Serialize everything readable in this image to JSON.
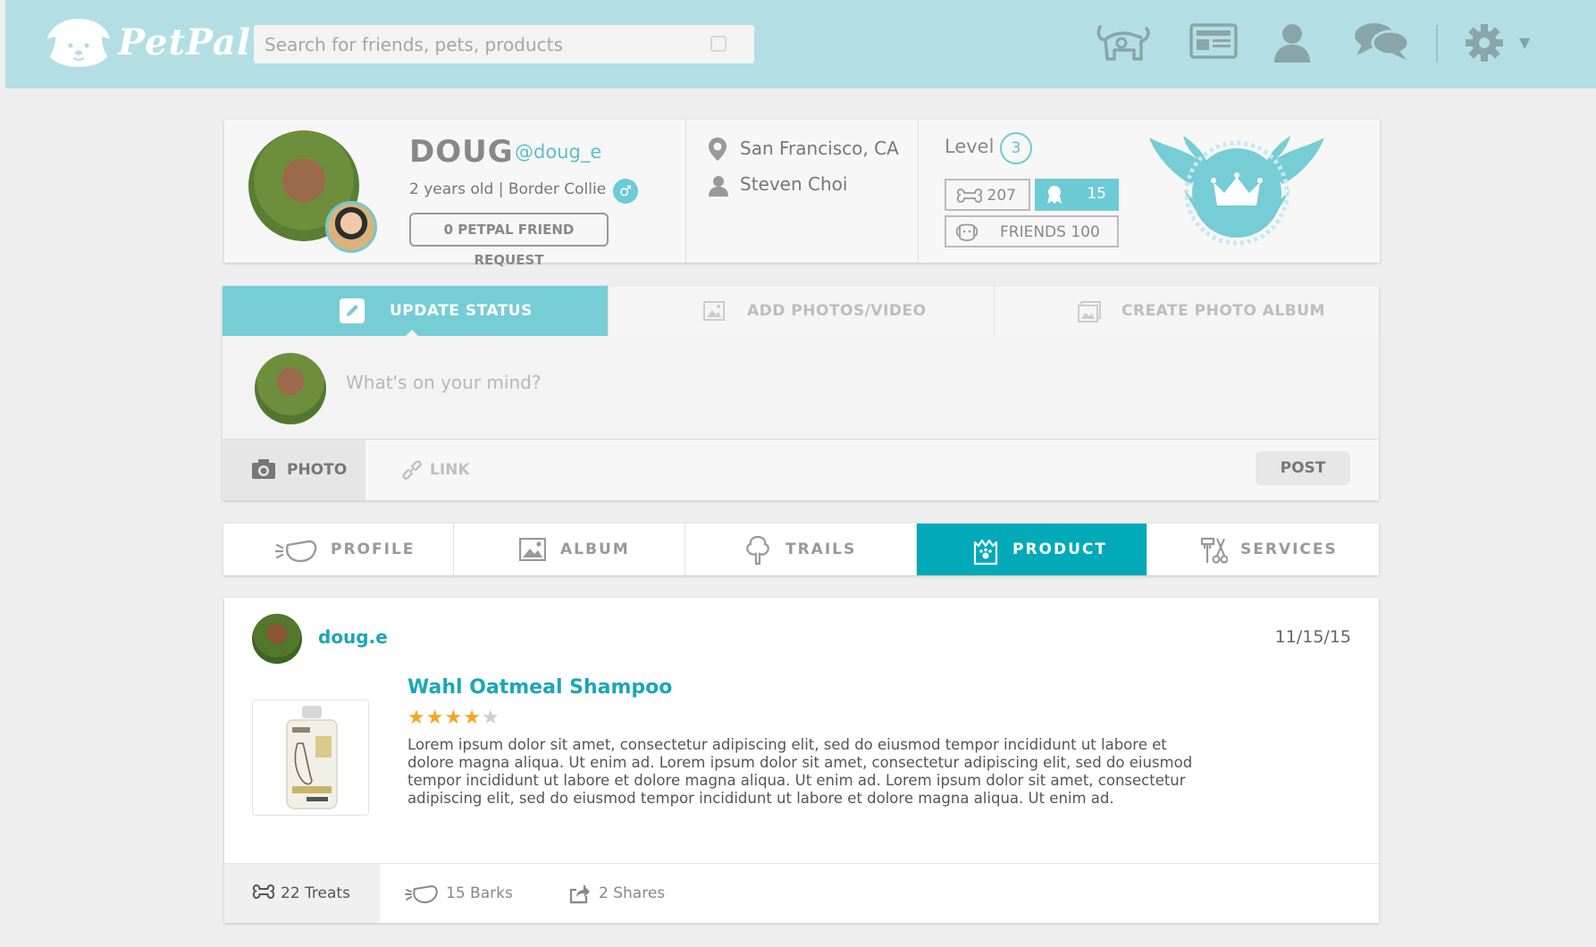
{
  "app": {
    "name": "PetPal"
  },
  "colors": {
    "brand": "#b3dfe4",
    "accent": "#00aab8",
    "accent_light": "#77cdd5",
    "star": "#f4a623"
  },
  "search": {
    "placeholder": "Search for friends, pets, products"
  },
  "nav_icons": [
    "pets-icon",
    "news-icon",
    "profile-icon",
    "messages-icon",
    "settings-icon"
  ],
  "profile": {
    "name": "DOUG",
    "handle": "@doug_e",
    "description": "2 years old | Border Collie",
    "gender_symbol": "♂",
    "friend_request_label": "0 PETPAL FRIEND REQUEST",
    "location": "San Francisco, CA",
    "owner": "Steven Choi",
    "level_label": "Level",
    "level": "3",
    "treats": "207",
    "awards": "15",
    "friends_label": "FRIENDS 100"
  },
  "composer": {
    "tabs": [
      {
        "label": "UPDATE STATUS",
        "active": true
      },
      {
        "label": "ADD PHOTOS/VIDEO",
        "active": false
      },
      {
        "label": "CREATE PHOTO ALBUM",
        "active": false
      }
    ],
    "placeholder": "What's on your mind?",
    "photo_label": "PHOTO",
    "link_label": "LINK",
    "post_label": "POST"
  },
  "section_tabs": [
    {
      "label": "PROFILE",
      "active": false
    },
    {
      "label": "ALBUM",
      "active": false
    },
    {
      "label": "TRAILS",
      "active": false
    },
    {
      "label": "PRODUCT",
      "active": true
    },
    {
      "label": "SERVICES",
      "active": false
    }
  ],
  "review": {
    "user": "doug.e",
    "date": "11/15/15",
    "product_title": "Wahl Oatmeal Shampoo",
    "rating": 4,
    "rating_max": 5,
    "body": "Lorem ipsum dolor sit amet, consectetur adipiscing elit, sed do eiusmod tempor incididunt ut labore et dolore magna aliqua. Ut enim ad. Lorem ipsum dolor sit amet, consectetur adipiscing elit, sed do eiusmod tempor incididunt ut labore et dolore magna aliqua. Ut enim ad. Lorem ipsum dolor sit amet, consectetur adipiscing elit, sed do eiusmod tempor incididunt ut labore et dolore magna aliqua. Ut enim ad.",
    "treats": "22 Treats",
    "barks": "15 Barks",
    "shares": "2 Shares"
  }
}
